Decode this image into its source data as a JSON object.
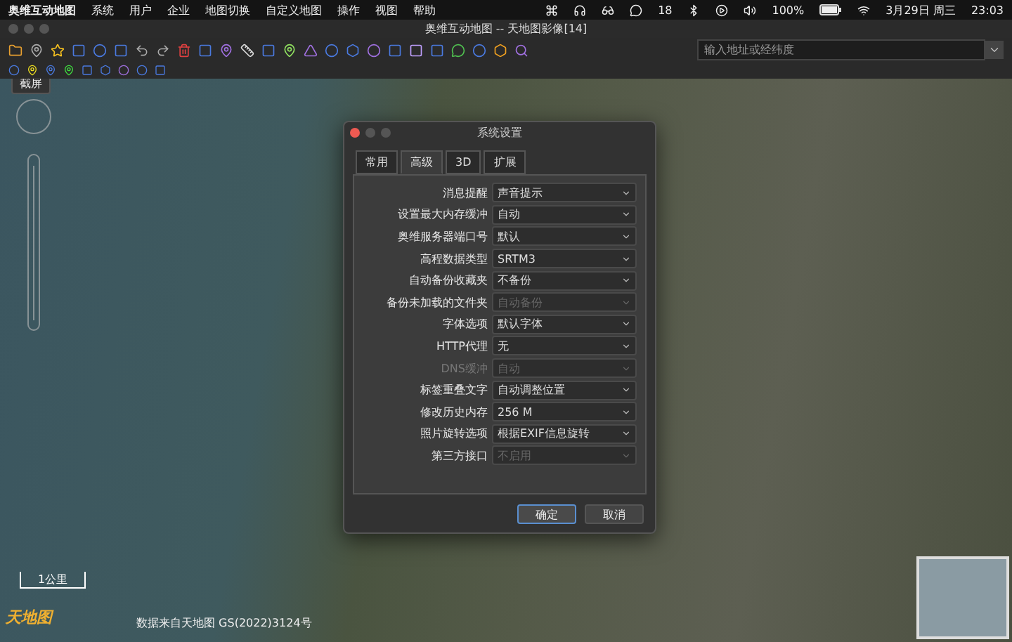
{
  "menu_bar": {
    "app": "奥维互动地图",
    "items": [
      "系统",
      "用户",
      "企业",
      "地图切换",
      "自定义地图",
      "操作",
      "视图",
      "帮助"
    ],
    "wechat_count": "18",
    "battery": "100%",
    "date": "3月29日 周三",
    "time": "23:03"
  },
  "window": {
    "title": "奥维互动地图 -- 天地图影像[14]"
  },
  "toolbar": {
    "search": {
      "placeholder": "输入地址或经纬度"
    }
  },
  "map": {
    "screenshot_button": "截屏",
    "scale": "1公里",
    "logo": "天地图",
    "attribution": "数据来自天地图 GS(2022)3124号"
  },
  "dialog": {
    "title": "系统设置",
    "tabs": [
      {
        "label": "常用",
        "selected": false
      },
      {
        "label": "高级",
        "selected": true
      },
      {
        "label": "3D",
        "selected": false
      },
      {
        "label": "扩展",
        "selected": false
      }
    ],
    "settings": [
      {
        "label": "消息提醒",
        "value": "声音提示",
        "disabled": false
      },
      {
        "label": "设置最大内存缓冲",
        "value": "自动",
        "disabled": false
      },
      {
        "label": "奥维服务器端口号",
        "value": "默认",
        "disabled": false
      },
      {
        "label": "高程数据类型",
        "value": "SRTM3",
        "disabled": false
      },
      {
        "label": "自动备份收藏夹",
        "value": "不备份",
        "disabled": false
      },
      {
        "label": "备份未加载的文件夹",
        "value": "自动备份",
        "disabled": true
      },
      {
        "label": "字体选项",
        "value": "默认字体",
        "disabled": false
      },
      {
        "label": "HTTP代理",
        "value": "无",
        "disabled": false
      },
      {
        "label": "DNS缓冲",
        "value": "自动",
        "disabled": true,
        "label_disabled": true
      },
      {
        "label": "标签重叠文字",
        "value": "自动调整位置",
        "disabled": false
      },
      {
        "label": "修改历史内存",
        "value": "256 M",
        "disabled": false
      },
      {
        "label": "照片旋转选项",
        "value": "根据EXIF信息旋转",
        "disabled": false
      },
      {
        "label": "第三方接口",
        "value": "不启用",
        "disabled": true
      }
    ],
    "buttons": [
      {
        "label": "确定",
        "kind": "primary"
      },
      {
        "label": "取消",
        "kind": "normal"
      }
    ]
  }
}
